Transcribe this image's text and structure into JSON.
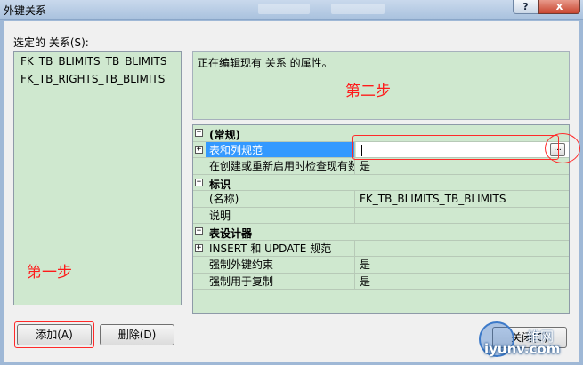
{
  "window": {
    "title": "外键关系",
    "help_label": "?",
    "close_label": "x"
  },
  "selected_label": "选定的 关系(S):",
  "relations": [
    "FK_TB_BLIMITS_TB_BLIMITS",
    "FK_TB_RIGHTS_TB_BLIMITS"
  ],
  "description": "正在编辑现有 关系 的属性。",
  "annotations": {
    "step1": "第一步",
    "step2": "第二步"
  },
  "properties": {
    "cat_general": "(常规)",
    "table_column_spec_name": "表和列规范",
    "table_column_spec_value": "",
    "check_existing_name": "在创建或重新启用时检查现有数",
    "check_existing_value": "是",
    "cat_identity": "标识",
    "name_name": "(名称)",
    "name_value": "FK_TB_BLIMITS_TB_BLIMITS",
    "desc_name": "说明",
    "desc_value": "",
    "cat_designer": "表设计器",
    "insert_update_name": "INSERT 和 UPDATE 规范",
    "insert_update_value": "",
    "enforce_fk_name": "强制外键约束",
    "enforce_fk_value": "是",
    "enforce_repl_name": "强制用于复制",
    "enforce_repl_value": "是",
    "ellipsis_label": "..."
  },
  "expanders": {
    "collapse": "−",
    "expand": "+"
  },
  "buttons": {
    "add": "添加(A)",
    "delete": "删除(D)",
    "close": "关闭(C)"
  },
  "watermark": {
    "top": "维网",
    "bottom": "iyunv.com"
  },
  "colors": {
    "annotation_red": "#ff1a1a",
    "panel_green": "#cfe8cf",
    "selection_blue": "#3399ff"
  }
}
